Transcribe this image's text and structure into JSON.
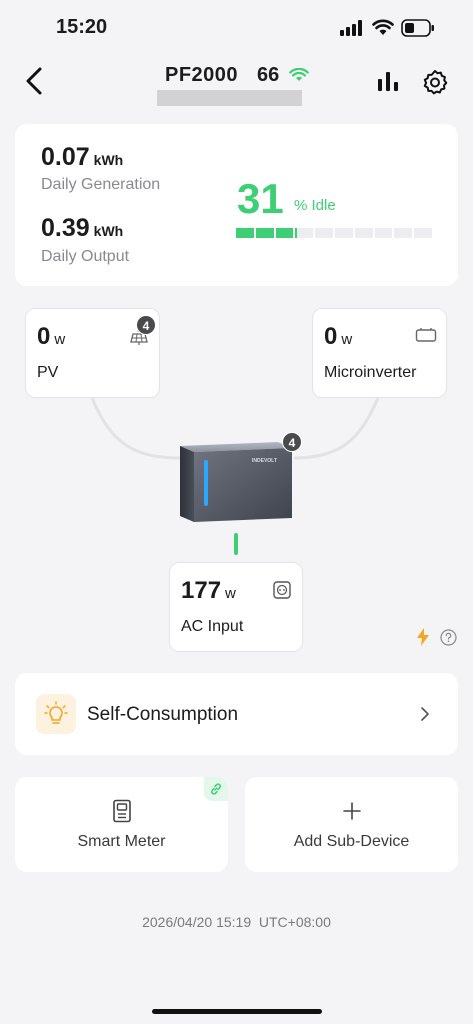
{
  "status_bar": {
    "time": "15:20"
  },
  "header": {
    "device_name": "PF2000",
    "signal_strength": "66"
  },
  "summary": {
    "generation_value": "0.07",
    "generation_unit": "kWh",
    "generation_label": "Daily Generation",
    "output_value": "0.39",
    "output_unit": "kWh",
    "output_label": "Daily Output",
    "idle_value": "31",
    "idle_label": "% Idle",
    "level_percent": 31
  },
  "pv": {
    "value": "0",
    "unit": "w",
    "label": "PV",
    "badge": "4"
  },
  "microinverter": {
    "value": "0",
    "unit": "w",
    "label": "Microinverter"
  },
  "inverter": {
    "badge": "4",
    "brand": "INDEVOLT"
  },
  "ac_input": {
    "value": "177",
    "unit": "w",
    "label": "AC Input"
  },
  "mode": {
    "label": "Self-Consumption"
  },
  "smart_meter": {
    "label": "Smart Meter"
  },
  "add_device": {
    "label": "Add Sub-Device"
  },
  "timestamp": "2026/04/20 15:19  UTC+08:00",
  "colors": {
    "accent_green": "#3ecf74",
    "warning_amber": "#f5a623",
    "badge_gray": "#4a4a4e"
  }
}
